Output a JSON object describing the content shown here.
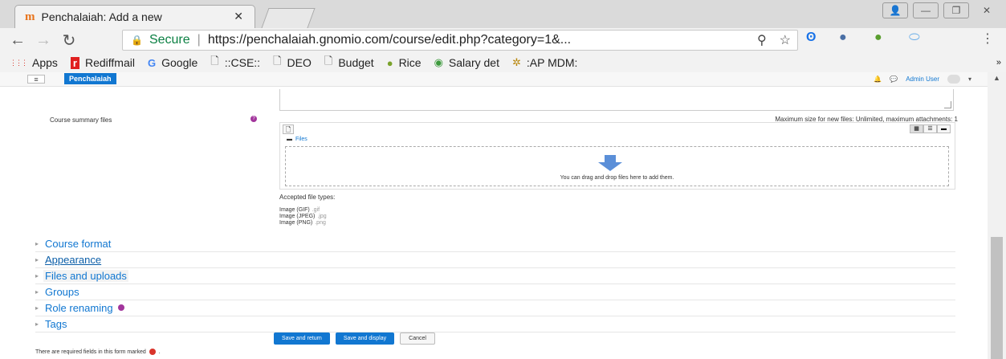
{
  "browser": {
    "tab_title": "Penchalaiah: Add a new",
    "tab_favicon": "moodle-favicon-icon",
    "tab_close": "✕",
    "omnibox": {
      "secure_label": "Secure",
      "separator": "|",
      "url": "https://penchalaiah.gnomio.com/course/edit.php?category=1&..."
    },
    "bookmarks": [
      {
        "label": "Apps",
        "icon": "apps-grid-icon",
        "color": "#d93025"
      },
      {
        "label": "Rediffmail",
        "icon": "rediffmail-icon",
        "color": "#e02020"
      },
      {
        "label": "Google",
        "icon": "google-icon",
        "color": "#4285f4"
      },
      {
        "label": "::CSE::",
        "icon": "page-icon",
        "color": "#555555"
      },
      {
        "label": "DEO",
        "icon": "page-icon",
        "color": "#555555"
      },
      {
        "label": "Budget",
        "icon": "page-icon",
        "color": "#555555"
      },
      {
        "label": "Rice",
        "icon": "rice-icon",
        "color": "#7aa22b"
      },
      {
        "label": "Salary det",
        "icon": "salary-icon",
        "color": "#3c9a3c"
      },
      {
        "label": ":AP MDM:",
        "icon": "mdm-icon",
        "color": "#b8860b"
      }
    ],
    "bookmarks_overflow": "»"
  },
  "moodle": {
    "navbar": {
      "menu_icon": "≡",
      "site_name": "Penchalaiah",
      "user_name": "Admin User"
    },
    "course_summary_files_label": "Course summary files",
    "max_size_text": "Maximum size for new files: Unlimited, maximum attachments: 1",
    "filemanager": {
      "path_label": "Files",
      "drop_text": "You can drag and drop files here to add them."
    },
    "accepted_label": "Accepted file types:",
    "accepted_types": [
      {
        "name": "Image (GIF)",
        "ext": ".gif"
      },
      {
        "name": "Image (JPEG)",
        "ext": ".jpg"
      },
      {
        "name": "Image (PNG)",
        "ext": ".png"
      }
    ],
    "sections": [
      {
        "label": "Course format"
      },
      {
        "label": "Appearance"
      },
      {
        "label": "Files and uploads"
      },
      {
        "label": "Groups"
      },
      {
        "label": "Role renaming"
      },
      {
        "label": "Tags"
      }
    ],
    "buttons": {
      "save_return": "Save and return",
      "save_display": "Save and display",
      "cancel": "Cancel"
    },
    "required_text": "There are required fields in this form marked",
    "required_suffix": ".",
    "accent_color": "#1177d1"
  }
}
